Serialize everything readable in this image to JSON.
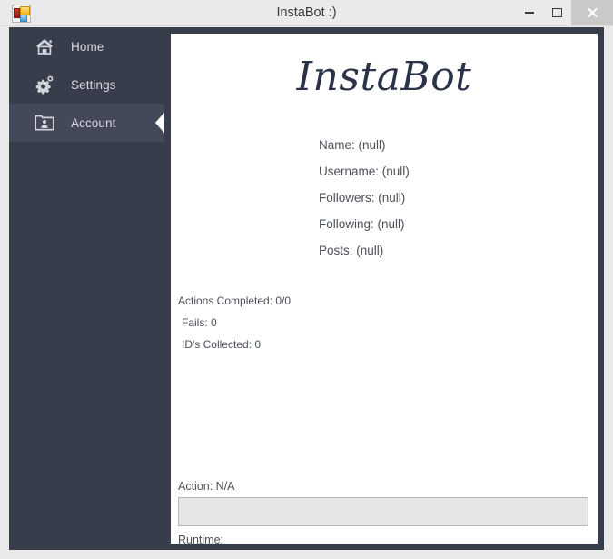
{
  "window": {
    "title": "InstaBot :)",
    "icon": "vs-form-icon",
    "controls": [
      {
        "name": "minimize",
        "glyph": "minimize-icon"
      },
      {
        "name": "maximize",
        "glyph": "maximize-icon"
      },
      {
        "name": "close",
        "glyph": "close-icon"
      }
    ],
    "colors": {
      "titlebar_bg": "#eaeaea",
      "sidebar_bg": "#373d4a",
      "sidebar_selected_bg": "#434959",
      "content_bg": "#ffffff",
      "brand_text": "#2b3247",
      "body_text": "#4c5058",
      "close_button_bg": "#c9c9c9"
    }
  },
  "sidebar": {
    "items": [
      {
        "label": "Home",
        "icon": "home-icon",
        "selected": false
      },
      {
        "label": "Settings",
        "icon": "gear-icon",
        "selected": false
      },
      {
        "label": "Account",
        "icon": "account-folder-icon",
        "selected": true
      }
    ]
  },
  "content": {
    "brand": "InstaBot",
    "profile": [
      {
        "label": "Name:",
        "value": "(null)"
      },
      {
        "label": "Username:",
        "value": "(null)"
      },
      {
        "label": "Followers:",
        "value": "(null)"
      },
      {
        "label": "Following:",
        "value": "(null)"
      },
      {
        "label": "Posts:",
        "value": "(null)"
      }
    ],
    "profile_lines": [
      "Name: (null)",
      "Username: (null)",
      "Followers: (null)",
      "Following: (null)",
      "Posts: (null)"
    ],
    "stats": [
      "Actions Completed: 0/0",
      "Fails: 0",
      "ID's Collected: 0"
    ],
    "stat_values": {
      "actions_completed": "0/0",
      "fails": "0",
      "ids_collected": "0"
    },
    "action_status": "Action: N/A",
    "runtime": "Runtime:",
    "progress_percent": 0
  }
}
